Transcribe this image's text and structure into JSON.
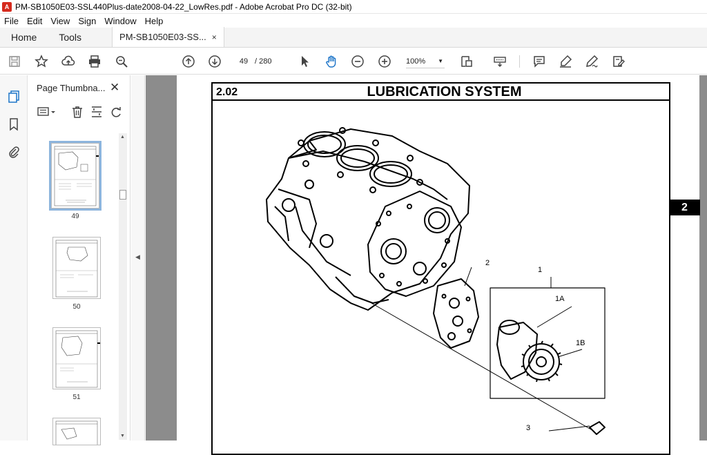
{
  "window": {
    "title": "PM-SB1050E03-SSL440Plus-date2008-04-22_LowRes.pdf - Adobe Acrobat Pro DC (32-bit)"
  },
  "menu": [
    "File",
    "Edit",
    "View",
    "Sign",
    "Window",
    "Help"
  ],
  "tabs": {
    "home": "Home",
    "tools": "Tools",
    "document": "PM-SB1050E03-SS...",
    "close": "×"
  },
  "toolbar": {
    "current_page": "49",
    "total_pages": "/ 280",
    "zoom": "100%",
    "icons": [
      "save-icon",
      "star-icon",
      "upload-cloud-icon",
      "print-icon",
      "zoom-search-icon",
      "page-up-icon",
      "page-down-icon",
      "select-arrow-icon",
      "hand-icon",
      "zoom-out-icon",
      "zoom-in-icon",
      "page-fit-icon",
      "keyboard-icon",
      "comment-icon",
      "highlight-icon",
      "sign-icon",
      "edit-text-icon"
    ]
  },
  "thumbnails": {
    "title": "Page Thumbna...",
    "close": "✕",
    "pages": [
      "49",
      "50",
      "51"
    ]
  },
  "document": {
    "section_number": "2.02",
    "section_title": "LUBRICATION SYSTEM",
    "chapter_tab": "2",
    "callouts": {
      "c1": "1",
      "c1a": "1A",
      "c1b": "1B",
      "c2": "2",
      "c3": "3"
    }
  }
}
